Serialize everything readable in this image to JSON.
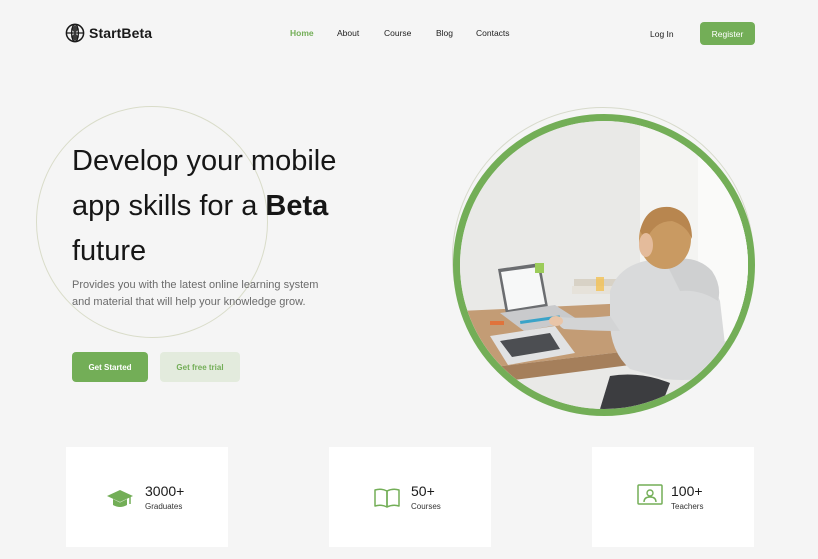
{
  "brand": {
    "name": "StartBeta",
    "logo_icon": "globe-icon",
    "accent_color": "#73ae57"
  },
  "nav": {
    "items": [
      {
        "label": "Home",
        "active": true
      },
      {
        "label": "About",
        "active": false
      },
      {
        "label": "Course",
        "active": false
      },
      {
        "label": "Blog",
        "active": false
      },
      {
        "label": "Contacts",
        "active": false
      }
    ],
    "login_label": "Log In",
    "register_label": "Register"
  },
  "hero": {
    "title_line1": "Develop your mobile",
    "title_line2_prefix": "app skills for a ",
    "title_line2_bold": "Beta",
    "title_line3": "future",
    "subtitle_line1": "Provides you with the latest online learning system",
    "subtitle_line2": "and material that will help your knowledge grow.",
    "primary_button": "Get Started",
    "secondary_button": "Get free trial",
    "image_subject": "student-with-laptop-photo"
  },
  "stats": [
    {
      "value": "3000+",
      "label": "Graduates",
      "icon": "graduation-cap-icon"
    },
    {
      "value": "50+",
      "label": "Courses",
      "icon": "open-book-icon"
    },
    {
      "value": "100+",
      "label": "Teachers",
      "icon": "teacher-board-icon"
    }
  ]
}
